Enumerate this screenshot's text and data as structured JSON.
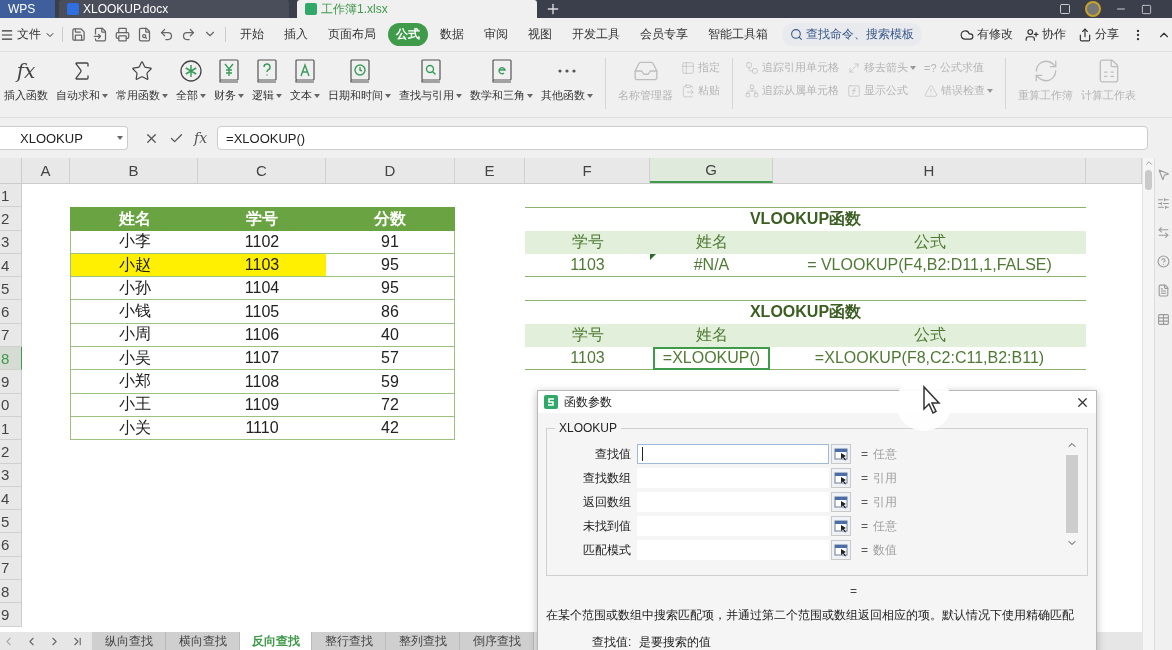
{
  "title_bar": {
    "tabs": [
      {
        "label": "WPS",
        "kind": "home",
        "selected": false
      },
      {
        "label": "XLOOKUP.docx",
        "kind": "doc",
        "selected": false
      },
      {
        "label": "工作簿1.xlsx",
        "kind": "sheet",
        "selected": true
      }
    ]
  },
  "menu_bar": {
    "file": "文件",
    "tabs": [
      {
        "label": "开始",
        "selected": false
      },
      {
        "label": "插入",
        "selected": false
      },
      {
        "label": "页面布局",
        "selected": false
      },
      {
        "label": "公式",
        "selected": true
      },
      {
        "label": "数据",
        "selected": false
      },
      {
        "label": "审阅",
        "selected": false
      },
      {
        "label": "视图",
        "selected": false
      },
      {
        "label": "开发工具",
        "selected": false
      },
      {
        "label": "会员专享",
        "selected": false
      },
      {
        "label": "智能工具箱",
        "selected": false
      }
    ],
    "search": {
      "placeholder": "查找命令、搜索模板"
    },
    "actions": [
      "有修改",
      "协作",
      "分享"
    ]
  },
  "ribbon": {
    "functions": [
      {
        "label": "插入函数",
        "dropdown": false,
        "symbol": "fx"
      },
      {
        "label": "自动求和",
        "dropdown": true
      },
      {
        "label": "常用函数",
        "dropdown": true
      },
      {
        "label": "全部",
        "dropdown": true
      },
      {
        "label": "财务",
        "dropdown": true
      },
      {
        "label": "逻辑",
        "dropdown": true
      },
      {
        "label": "文本",
        "dropdown": true
      },
      {
        "label": "日期和时间",
        "dropdown": true
      },
      {
        "label": "查找与引用",
        "dropdown": true
      },
      {
        "label": "数学和三角",
        "dropdown": true
      },
      {
        "label": "其他函数",
        "dropdown": true
      }
    ],
    "tool_groups": [
      {
        "kind": "large",
        "items": [
          {
            "label": "名称管理器",
            "dropdown": false,
            "disabled": true
          }
        ]
      },
      {
        "kind": "stack",
        "items": [
          {
            "label": "指定",
            "dropdown": false,
            "disabled": true
          },
          {
            "label": "粘贴",
            "dropdown": false,
            "disabled": true
          }
        ]
      },
      {
        "kind": "stack",
        "items": [
          {
            "label": "追踪引用单元格",
            "dropdown": false,
            "disabled": true
          },
          {
            "label": "追踪从属单元格",
            "dropdown": false,
            "disabled": true
          }
        ]
      },
      {
        "kind": "stack",
        "items": [
          {
            "label": "移去箭头",
            "dropdown": true,
            "disabled": true
          },
          {
            "label": "显示公式",
            "dropdown": false,
            "disabled": true
          }
        ]
      },
      {
        "kind": "stack",
        "items": [
          {
            "label": "公式求值",
            "dropdown": false,
            "disabled": true,
            "symbol": "=?"
          },
          {
            "label": "错误检查",
            "dropdown": true,
            "disabled": true
          }
        ]
      },
      {
        "kind": "large",
        "items": [
          {
            "label": "重算工作簿",
            "dropdown": false,
            "disabled": true
          }
        ]
      },
      {
        "kind": "large",
        "items": [
          {
            "label": "计算工作表",
            "dropdown": false,
            "disabled": true
          }
        ]
      }
    ]
  },
  "formula_bar": {
    "name_box": "XLOOKUP",
    "function_symbol": "fx",
    "formula": "=XLOOKUP()"
  },
  "columns": [
    {
      "label": "A",
      "selected": false
    },
    {
      "label": "B",
      "selected": false
    },
    {
      "label": "C",
      "selected": false
    },
    {
      "label": "D",
      "selected": false
    },
    {
      "label": "E",
      "selected": false
    },
    {
      "label": "F",
      "selected": false
    },
    {
      "label": "G",
      "selected": true
    },
    {
      "label": "H",
      "selected": false
    }
  ],
  "rows": [
    {
      "label": "1",
      "selected": false
    },
    {
      "label": "2",
      "selected": false
    },
    {
      "label": "3",
      "selected": false
    },
    {
      "label": "4",
      "selected": false
    },
    {
      "label": "5",
      "selected": false
    },
    {
      "label": "6",
      "selected": false
    },
    {
      "label": "7",
      "selected": false
    },
    {
      "label": "8",
      "selected": true
    },
    {
      "label": "9",
      "selected": false
    },
    {
      "label": "0",
      "selected": false
    },
    {
      "label": "1",
      "selected": false
    },
    {
      "label": "2",
      "selected": false
    },
    {
      "label": "3",
      "selected": false
    },
    {
      "label": "4",
      "selected": false
    },
    {
      "label": "5",
      "selected": false
    },
    {
      "label": "6",
      "selected": false
    },
    {
      "label": "7",
      "selected": false
    },
    {
      "label": "8",
      "selected": false
    },
    {
      "label": "9",
      "selected": false
    }
  ],
  "score_table": {
    "headers": [
      "姓名",
      "学号",
      "分数"
    ],
    "rows": [
      {
        "cells": [
          {
            "text": "小李",
            "highlighted": false
          },
          {
            "text": "1102",
            "highlighted": false
          },
          {
            "text": "91",
            "highlighted": false
          }
        ]
      },
      {
        "cells": [
          {
            "text": "小赵",
            "highlighted": true
          },
          {
            "text": "1103",
            "highlighted": true
          },
          {
            "text": "95",
            "highlighted": false
          }
        ]
      },
      {
        "cells": [
          {
            "text": "小孙",
            "highlighted": false
          },
          {
            "text": "1104",
            "highlighted": false
          },
          {
            "text": "95",
            "highlighted": false
          }
        ]
      },
      {
        "cells": [
          {
            "text": "小钱",
            "highlighted": false
          },
          {
            "text": "1105",
            "highlighted": false
          },
          {
            "text": "86",
            "highlighted": false
          }
        ]
      },
      {
        "cells": [
          {
            "text": "小周",
            "highlighted": false
          },
          {
            "text": "1106",
            "highlighted": false
          },
          {
            "text": "40",
            "highlighted": false
          }
        ]
      },
      {
        "cells": [
          {
            "text": "小吴",
            "highlighted": false
          },
          {
            "text": "1107",
            "highlighted": false
          },
          {
            "text": "57",
            "highlighted": false
          }
        ]
      },
      {
        "cells": [
          {
            "text": "小郑",
            "highlighted": false
          },
          {
            "text": "1108",
            "highlighted": false
          },
          {
            "text": "59",
            "highlighted": false
          }
        ]
      },
      {
        "cells": [
          {
            "text": "小王",
            "highlighted": false
          },
          {
            "text": "1109",
            "highlighted": false
          },
          {
            "text": "72",
            "highlighted": false
          }
        ]
      },
      {
        "cells": [
          {
            "text": "小关",
            "highlighted": false
          },
          {
            "text": "1110",
            "highlighted": false
          },
          {
            "text": "42",
            "highlighted": false
          }
        ]
      }
    ]
  },
  "lookup_sections": [
    {
      "title": "VLOOKUP函数",
      "headers": [
        "学号",
        "姓名",
        "公式"
      ],
      "values": [
        {
          "text": "1103",
          "active": false,
          "error_marker": false
        },
        {
          "text": "#N/A",
          "active": false,
          "error_marker": true
        },
        {
          "text": "= VLOOKUP(F4,B2:D11,1,FALSE)",
          "active": false,
          "error_marker": false
        }
      ]
    },
    {
      "title": "XLOOKUP函数",
      "headers": [
        "学号",
        "姓名",
        "公式"
      ],
      "values": [
        {
          "text": "1103",
          "active": false,
          "error_marker": false
        },
        {
          "text": "=XLOOKUP()",
          "active": true,
          "error_marker": false
        },
        {
          "text": "=XLOOKUP(F8,C2:C11,B2:B11)",
          "active": false,
          "error_marker": false
        }
      ]
    }
  ],
  "dialog": {
    "title": "函数参数",
    "function": "XLOOKUP",
    "params": [
      {
        "label": "查找值",
        "equals": "=",
        "hint": "任意",
        "focused": true
      },
      {
        "label": "查找数组",
        "equals": "=",
        "hint": "引用",
        "focused": false
      },
      {
        "label": "返回数组",
        "equals": "=",
        "hint": "引用",
        "focused": false
      },
      {
        "label": "未找到值",
        "equals": "=",
        "hint": "任意",
        "focused": false
      },
      {
        "label": "匹配模式",
        "equals": "=",
        "hint": "数值",
        "focused": false
      }
    ],
    "result": "=",
    "description": "在某个范围或数组中搜索匹配项，并通过第二个范围或数组返回相应的项。默认情况下使用精确匹配",
    "param_help": {
      "label": "查找值:",
      "text": "是要搜索的值"
    }
  },
  "sheet_tabs": [
    {
      "label": "纵向查找",
      "selected": false
    },
    {
      "label": "横向查找",
      "selected": false
    },
    {
      "label": "反向查找",
      "selected": true
    },
    {
      "label": "整行查找",
      "selected": false
    },
    {
      "label": "整列查找",
      "selected": false
    },
    {
      "label": "倒序查找",
      "selected": false
    }
  ]
}
